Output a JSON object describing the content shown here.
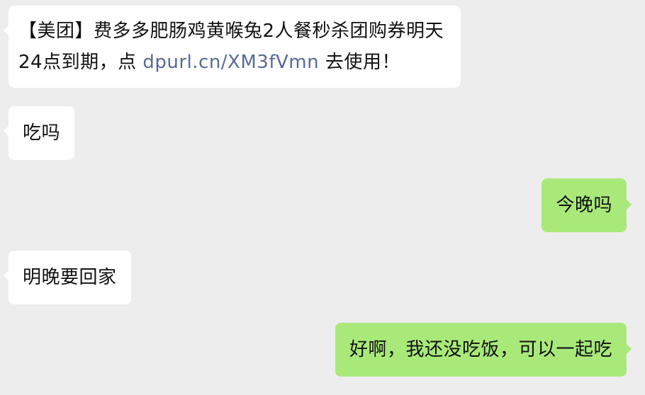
{
  "messages": [
    {
      "side": "incoming",
      "text_before": "【美团】费多多肥肠鸡黄喉兔2人餐秒杀团购券明天24点到期，点 ",
      "link": "dpurl.cn/XM3fVmn",
      "text_after": " 去使用！"
    },
    {
      "side": "incoming",
      "text": "吃吗"
    },
    {
      "side": "outgoing",
      "text": "今晚吗"
    },
    {
      "side": "incoming",
      "text": "明晚要回家"
    },
    {
      "side": "outgoing",
      "text": "好啊，我还没吃饭，可以一起吃"
    }
  ],
  "colors": {
    "background": "#ededed",
    "incoming_bubble": "#ffffff",
    "outgoing_bubble": "#a9e97a",
    "link": "#576b95"
  }
}
